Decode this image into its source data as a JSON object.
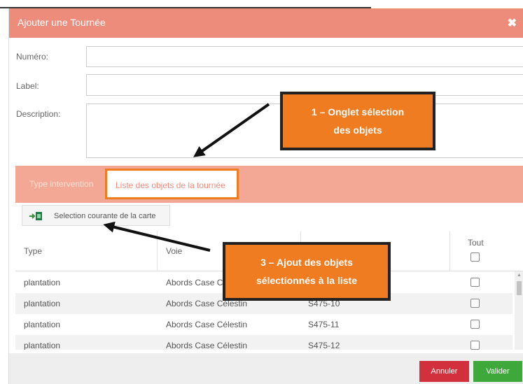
{
  "modal": {
    "title": "Ajouter une Tournée",
    "close_glyph": "✖"
  },
  "form": {
    "numero_label": "Numéro:",
    "label_label": "Label:",
    "description_label": "Description:"
  },
  "tabs": [
    {
      "label": "Type intervention",
      "active": false
    },
    {
      "label": "Liste des objets de la tournée",
      "active": true
    }
  ],
  "selection_button": {
    "label": "Selection courante de la carte",
    "icon": "map-selection-add-icon"
  },
  "table": {
    "headers": {
      "type": "Type",
      "voie": "Voie",
      "tout": "Tout"
    },
    "rows": [
      {
        "type": "plantation",
        "voie": "Abords Case Célestin",
        "id": ""
      },
      {
        "type": "plantation",
        "voie": "Abords Case Célestin",
        "id": "S475-10"
      },
      {
        "type": "plantation",
        "voie": "Abords Case Célestin",
        "id": "S475-11"
      },
      {
        "type": "plantation",
        "voie": "Abords Case Célestin",
        "id": "S475-12"
      }
    ]
  },
  "footer": {
    "cancel_label": "Annuler",
    "validate_label": "Valider"
  },
  "callouts": {
    "one": {
      "line1": "1 – Onglet sélection",
      "line2": "des objets"
    },
    "three": {
      "line1": "3 – Ajout des objets",
      "line2": "sélectionnés à la liste"
    }
  },
  "colors": {
    "header": "#ee8c7c",
    "tab_bar": "#f3a895",
    "callout": "#f07c21",
    "cancel": "#d2303c",
    "validate": "#3fa83a"
  }
}
